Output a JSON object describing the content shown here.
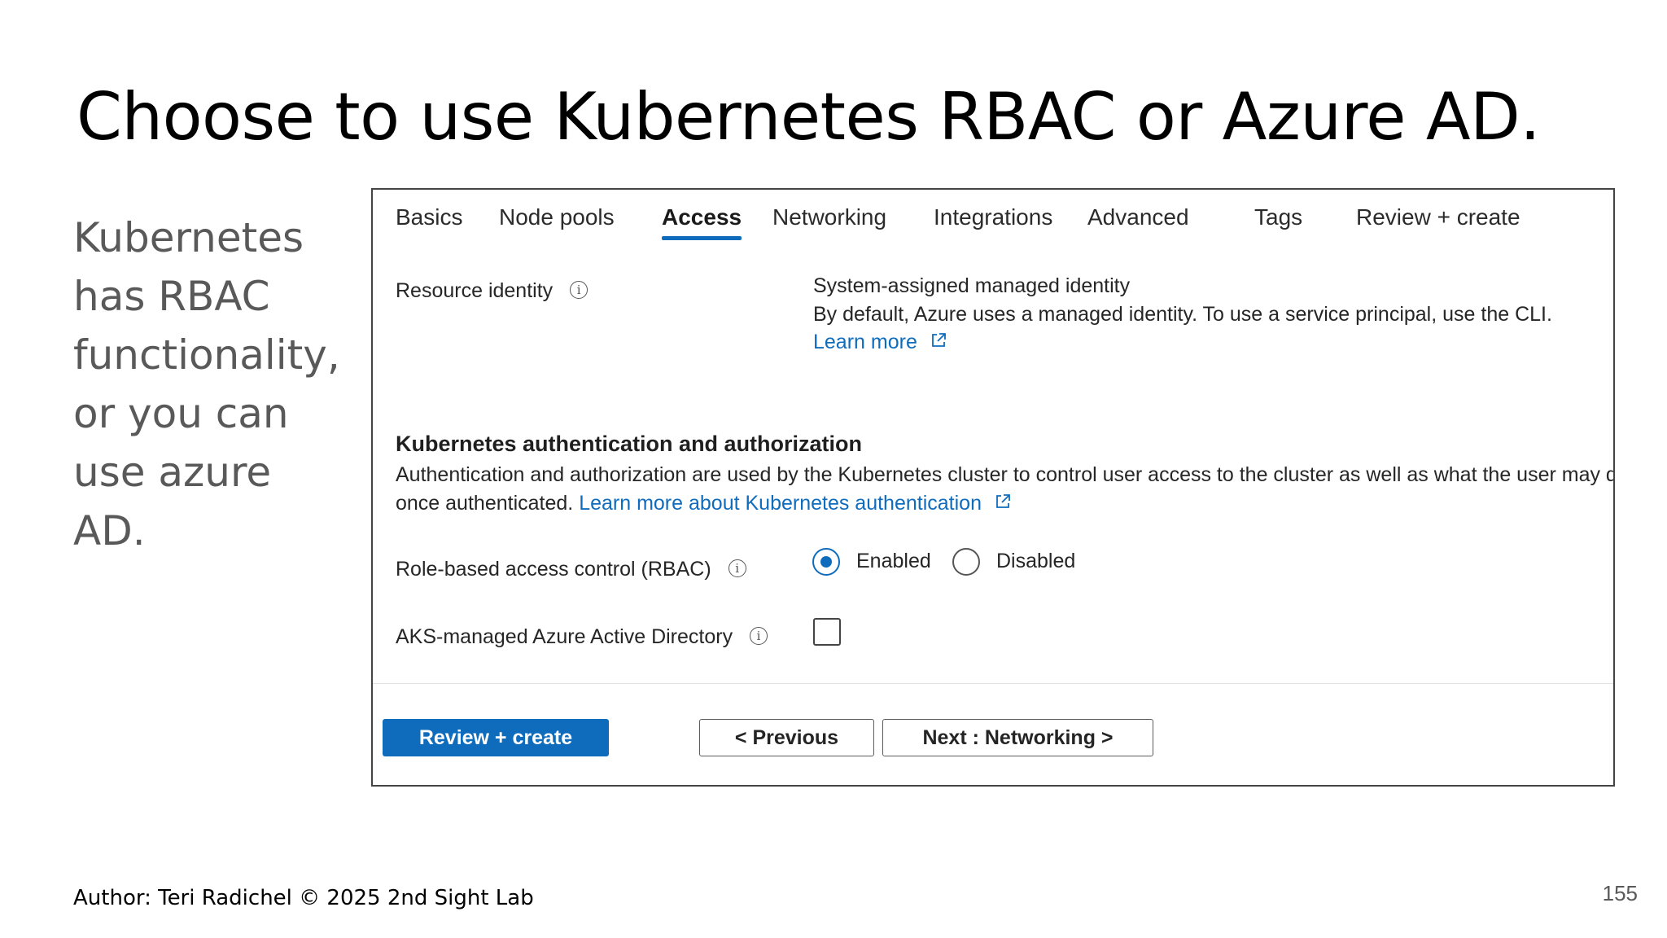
{
  "slide": {
    "title": "Choose to use Kubernetes RBAC or Azure AD.",
    "side_text_lines": [
      "Kubernetes",
      "has RBAC",
      "functionality,",
      "or you can",
      "use azure",
      "AD."
    ],
    "author": "Author: Teri Radichel © 2025 2nd Sight Lab",
    "page_number": "155"
  },
  "colors": {
    "accent": "#0f6cbd",
    "text": "#262626",
    "side_text": "#595959"
  },
  "tabs": [
    {
      "label": "Basics",
      "active": false
    },
    {
      "label": "Node pools",
      "active": false
    },
    {
      "label": "Access",
      "active": true
    },
    {
      "label": "Networking",
      "active": false
    },
    {
      "label": "Integrations",
      "active": false
    },
    {
      "label": "Advanced",
      "active": false
    },
    {
      "label": "Tags",
      "active": false
    },
    {
      "label": "Review + create",
      "active": false
    }
  ],
  "resource_identity": {
    "label": "Resource identity",
    "info_icon": "info-icon",
    "value": "System-assigned managed identity",
    "description": "By default, Azure uses a managed identity. To use a service principal, use the CLI.",
    "link": "Learn more",
    "link_icon": "external-link-icon"
  },
  "auth_section": {
    "title": "Kubernetes authentication and authorization",
    "description": "Authentication and authorization are used by the Kubernetes cluster to control user access to the cluster as well as what the user may do once authenticated.",
    "link": "Learn more about Kubernetes authentication",
    "link_icon": "external-link-icon"
  },
  "rbac": {
    "label": "Role-based access control (RBAC)",
    "info_icon": "info-icon",
    "options": [
      {
        "label": "Enabled",
        "selected": true
      },
      {
        "label": "Disabled",
        "selected": false
      }
    ]
  },
  "aad": {
    "label": "AKS-managed Azure Active Directory",
    "info_icon": "info-icon",
    "checked": false
  },
  "buttons": {
    "review_create": "Review + create",
    "previous": "< Previous",
    "next": "Next : Networking >"
  }
}
